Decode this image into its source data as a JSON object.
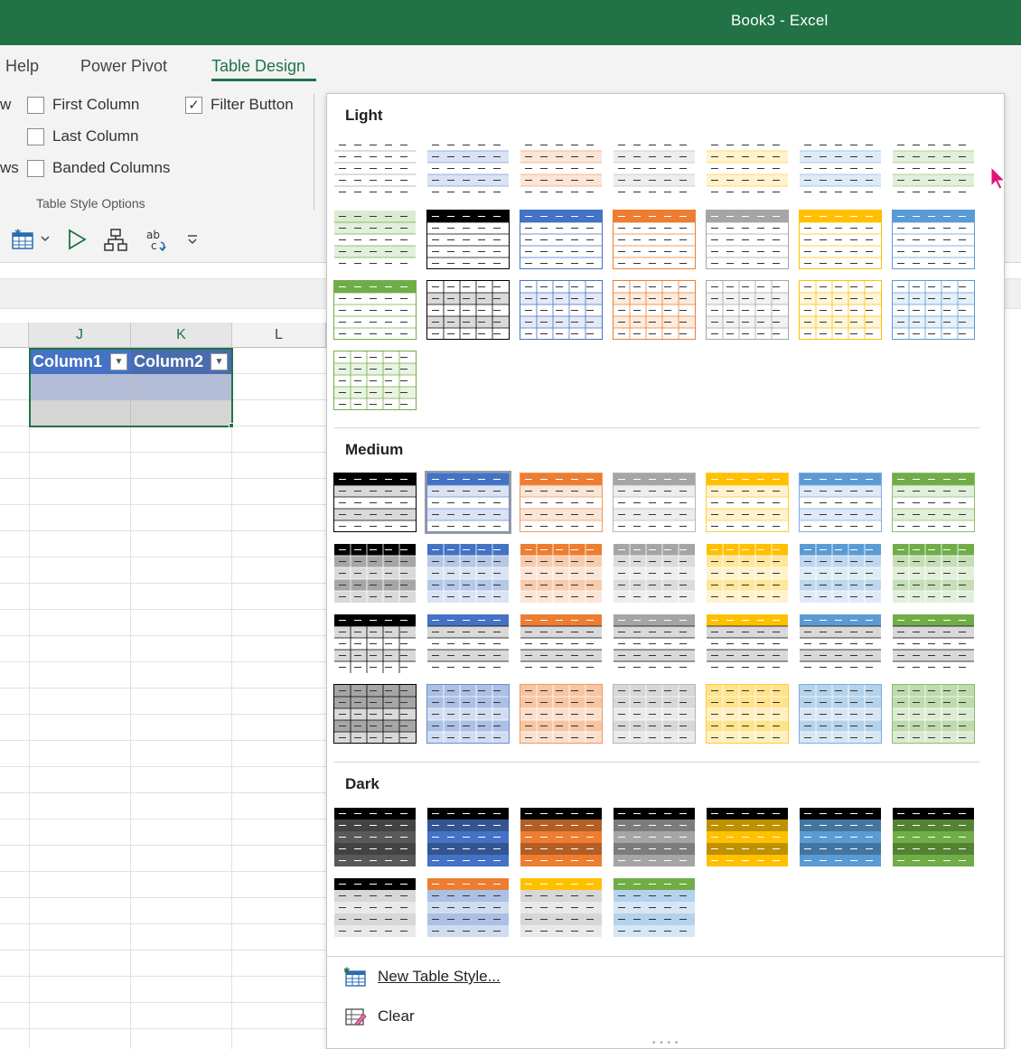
{
  "window": {
    "title": "Book3  -  Excel"
  },
  "tabs": [
    {
      "label": "Help",
      "active": false
    },
    {
      "label": "Power Pivot",
      "active": false
    },
    {
      "label": "Table Design",
      "active": true
    }
  ],
  "ribbon": {
    "partial_left": [
      "w",
      "ws"
    ],
    "options": [
      {
        "label": "First Column",
        "checked": false
      },
      {
        "label": "Last Column",
        "checked": false
      },
      {
        "label": "Banded Columns",
        "checked": false
      },
      {
        "label": "Filter Button",
        "checked": true
      }
    ],
    "group_label": "Table Style Options"
  },
  "quick_access_icons": [
    "table-icon",
    "dropdown-arrow-icon",
    "play-icon",
    "hierarchy-icon",
    "spelling-icon",
    "customize-toolbar-icon"
  ],
  "sheet": {
    "columns": [
      "J",
      "K",
      "L"
    ],
    "table": {
      "headers": [
        "Column1",
        "Column2"
      ]
    }
  },
  "gallery": {
    "sections": [
      {
        "title": "Light"
      },
      {
        "title": "Medium"
      },
      {
        "title": "Dark"
      }
    ],
    "menu": {
      "new_style": "New Table Style...",
      "clear": "Clear"
    }
  },
  "colors": {
    "excel_green": "#217346",
    "header_blue": "#4472c4",
    "accents": [
      "#000000",
      "#4472c4",
      "#ed7d31",
      "#a5a5a5",
      "#ffc000",
      "#5b9bd5",
      "#70ad47"
    ]
  }
}
